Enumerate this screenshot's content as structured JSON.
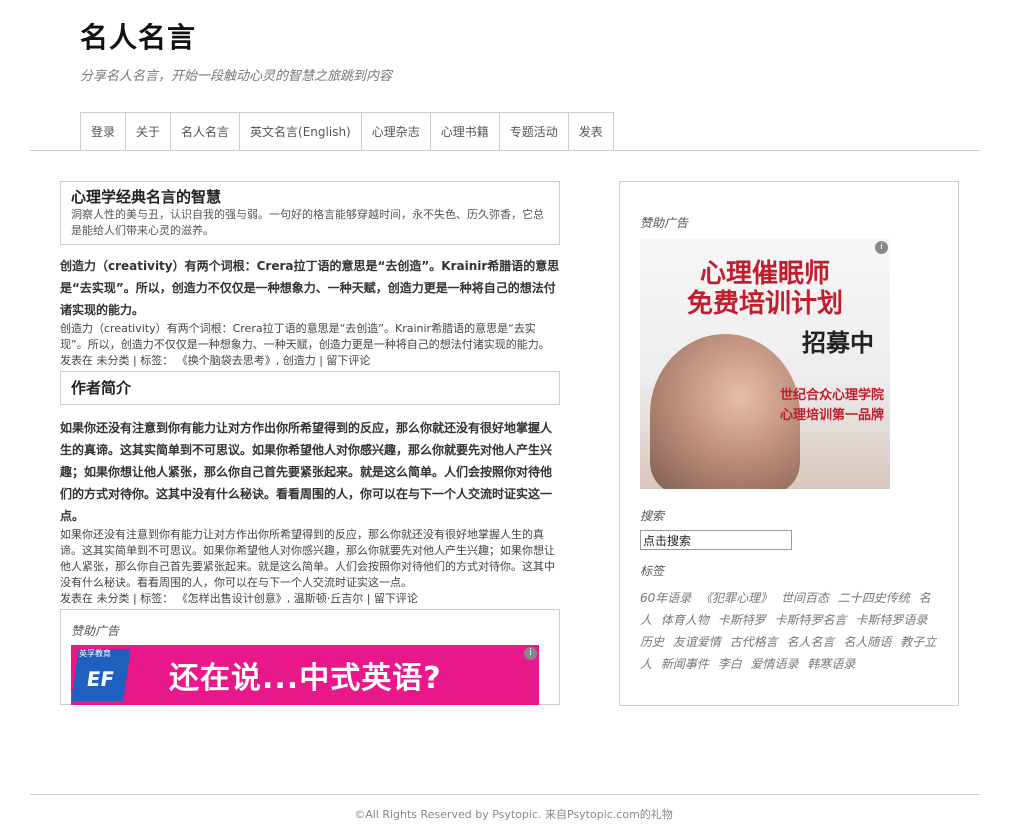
{
  "site": {
    "title": "名人名言",
    "tagline": "分享名人名言，开始一段触动心灵的智慧之旅跳到内容"
  },
  "nav": [
    "登录",
    "关于",
    "名人名言",
    "英文名言(English)",
    "心理杂志",
    "心理书籍",
    "专题活动",
    "发表"
  ],
  "posts": [
    {
      "title": "心理学经典名言的智慧",
      "excerpt": "洞察人性的美与丑，认识自我的强与弱。一句好的格言能够穿越时间，永不失色、历久弥香，它总是能给人们带来心灵的滋养。",
      "bold": "创造力（creativity）有两个词根：Crera拉丁语的意思是“去创造”。Krainir希腊语的意思是“去实现”。所以，创造力不仅仅是一种想象力、一种天赋，创造力更是一种将自己的想法付诸实现的能力。",
      "plain": "创造力（creativity）有两个词根：Crera拉丁语的意思是“去创造”。Krainir希腊语的意思是“去实现”。所以，创造力不仅仅是一种想象力、一种天赋，创造力更是一种将自己的想法付诸实现的能力。",
      "meta_prefix": "发表在",
      "category": "未分类",
      "tags_prefix": "| 标签：",
      "tags": "《换个脑袋去思考》, 创造力",
      "comment": "留下评论"
    },
    {
      "title": "作者简介",
      "bold": "如果你还没有注意到你有能力让对方作出你所希望得到的反应，那么你就还没有很好地掌握人生的真谛。这其实简单到不可思议。如果你希望他人对你感兴趣，那么你就要先对他人产生兴趣；如果你想让他人紧张，那么你自己首先要紧张起来。就是这么简单。人们会按照你对待他们的方式对待你。这其中没有什么秘诀。看看周围的人，你可以在与下一个人交流时证实这一点。",
      "plain": "如果你还没有注意到你有能力让对方作出你所希望得到的反应，那么你就还没有很好地掌握人生的真谛。这其实简单到不可思议。如果你希望他人对你感兴趣，那么你就要先对他人产生兴趣；如果你想让他人紧张，那么你自己首先要紧张起来。就是这么简单。人们会按照你对待他们的方式对待你。这其中没有什么秘诀。看看周围的人，你可以在与下一个人交流时证实这一点。",
      "meta_prefix": "发表在",
      "category": "未分类",
      "tags_prefix": "| 标签：",
      "tags": "《怎样出售设计创意》, 温斯顿·丘吉尔",
      "comment": "留下评论"
    }
  ],
  "main_ad": {
    "label": "赞助广告",
    "logo_top": "英孚教育",
    "logo": "EF",
    "text": "还在说...中式英语?",
    "adchoice": "i"
  },
  "sidebar": {
    "ad_label": "赞助广告",
    "ad": {
      "line1": "心理催眠师",
      "line2": "免费培训计划",
      "line3": "招募中",
      "line4": "世纪合众心理学院",
      "line5": "心理培训第一品牌",
      "adchoice": "i"
    },
    "search_label": "搜索",
    "search_value": "点击搜索",
    "tags_label": "标签",
    "tags": [
      "60年语录",
      "《犯罪心理》",
      "世间百态",
      "二十四史传统",
      "名人",
      "体育人物",
      "卡斯特罗",
      "卡斯特罗名言",
      "卡斯特罗语录",
      "历史",
      "友谊爱情",
      "古代格言",
      "名人名言",
      "名人随语",
      "教子立人",
      "新闻事件",
      "李白",
      "爱情语录",
      "韩寒语录"
    ]
  },
  "footer": "©All Rights Reserved by Psytopic. 来自Psytopic.com的礼物",
  "colors": {
    "banner": "#e8178a",
    "ad_red": "#c01e2c",
    "border": "#cccccc"
  }
}
